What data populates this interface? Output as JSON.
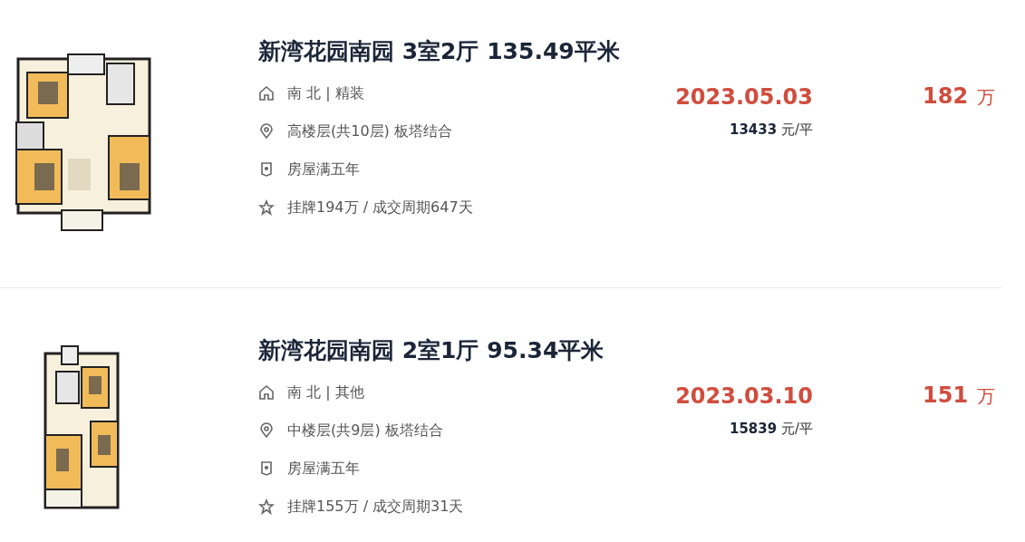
{
  "listings": [
    {
      "title": "新湾花园南园 3室2厅 135.49平米",
      "plan": {
        "kind": "wide"
      },
      "info": [
        {
          "kind": "house",
          "text": "南 北 | 精装"
        },
        {
          "kind": "location",
          "text": "高楼层(共10层) 板塔结合"
        },
        {
          "kind": "badge",
          "text": "房屋满五年"
        },
        {
          "kind": "star",
          "text": "挂牌194万 / 成交周期647天"
        }
      ],
      "deal_date": "2023.05.03",
      "unit_price": "13433",
      "unit_price_suffix": "元/平",
      "price": "182",
      "price_unit": "万"
    },
    {
      "title": "新湾花园南园 2室1厅 95.34平米",
      "plan": {
        "kind": "narrow"
      },
      "info": [
        {
          "kind": "house",
          "text": "南 北 | 其他"
        },
        {
          "kind": "location",
          "text": "中楼层(共9层) 板塔结合"
        },
        {
          "kind": "badge",
          "text": "房屋满五年"
        },
        {
          "kind": "star",
          "text": "挂牌155万 / 成交周期31天"
        }
      ],
      "deal_date": "2023.03.10",
      "unit_price": "15839",
      "unit_price_suffix": "元/平",
      "price": "151",
      "price_unit": "万"
    }
  ]
}
